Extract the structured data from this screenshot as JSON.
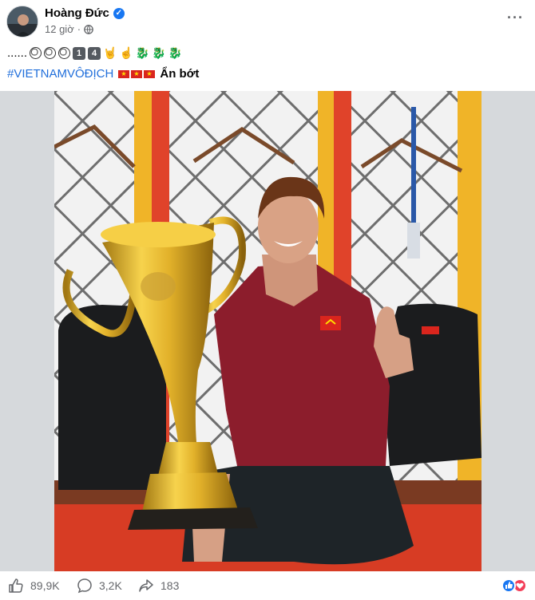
{
  "post": {
    "author": "Hoàng Đức",
    "time": "12 giờ",
    "caption_dots": "......",
    "hashtag": "#VIETNAMVÔĐỊCH",
    "see_less": "Ẩn bớt",
    "keycaps": [
      "1",
      "4"
    ]
  },
  "stats": {
    "likes": "89,9K",
    "comments": "3,2K",
    "shares": "183"
  },
  "icons": {
    "verified": "verified-badge-icon",
    "privacy": "globe-icon",
    "more": "more-options-icon",
    "like": "like-icon",
    "comment": "comment-icon",
    "share": "share-icon"
  },
  "colors": {
    "link": "#216fdb",
    "verified": "#1877f2",
    "like_reaction": "#1877f2",
    "love_reaction": "#f33e58"
  }
}
